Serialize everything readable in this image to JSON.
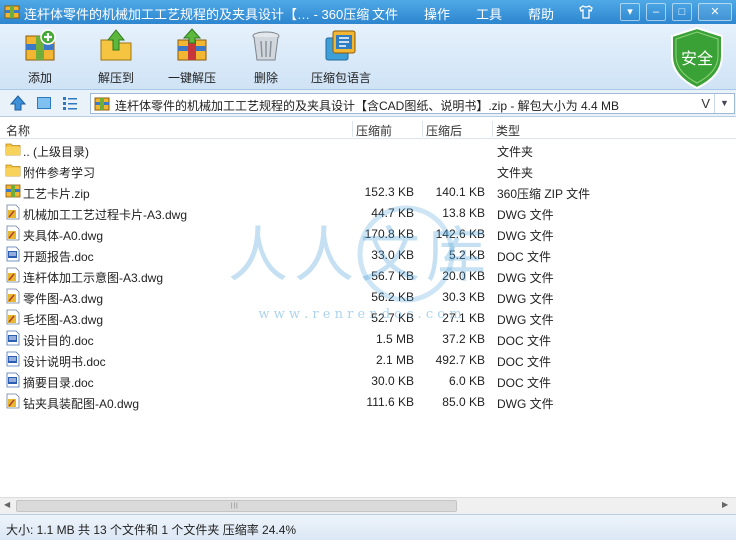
{
  "title_bar": {
    "title": "连杆体零件的机械加工工艺规程的及夹具设计【… - 360压缩",
    "menus": [
      "文件",
      "操作",
      "工具",
      "帮助"
    ]
  },
  "toolbar": {
    "buttons": [
      "添加",
      "解压到",
      "一键解压",
      "删除",
      "压缩包语言"
    ],
    "badge": "安全"
  },
  "address": {
    "path": "连杆体零件的机械加工工艺规程的及夹具设计【含CAD图纸、说明书】.zip - 解包大小为 4.4 MB",
    "dropdown_glyph": "V"
  },
  "columns": [
    "名称",
    "压缩前",
    "压缩后",
    "类型"
  ],
  "files": [
    {
      "name": ".. (上级目录)",
      "compressed": "",
      "uncompressed": "",
      "type": "文件夹",
      "icon": "folder-icon"
    },
    {
      "name": "附件参考学习",
      "compressed": "",
      "uncompressed": "",
      "type": "文件夹",
      "icon": "folder-icon"
    },
    {
      "name": "工艺卡片.zip",
      "compressed": "152.3 KB",
      "uncompressed": "140.1 KB",
      "type": "360压缩 ZIP 文件",
      "icon": "zip-icon"
    },
    {
      "name": "机械加工工艺过程卡片-A3.dwg",
      "compressed": "44.7 KB",
      "uncompressed": "13.8 KB",
      "type": "DWG 文件",
      "icon": "dwg-icon"
    },
    {
      "name": "夹具体-A0.dwg",
      "compressed": "170.8 KB",
      "uncompressed": "142.6 KB",
      "type": "DWG 文件",
      "icon": "dwg-icon"
    },
    {
      "name": "开题报告.doc",
      "compressed": "33.0 KB",
      "uncompressed": "5.2 KB",
      "type": "DOC 文件",
      "icon": "doc-icon"
    },
    {
      "name": "连杆体加工示意图-A3.dwg",
      "compressed": "56.7 KB",
      "uncompressed": "20.0 KB",
      "type": "DWG 文件",
      "icon": "dwg-icon"
    },
    {
      "name": "零件图-A3.dwg",
      "compressed": "56.2 KB",
      "uncompressed": "30.3 KB",
      "type": "DWG 文件",
      "icon": "dwg-icon"
    },
    {
      "name": "毛坯图-A3.dwg",
      "compressed": "52.7 KB",
      "uncompressed": "27.1 KB",
      "type": "DWG 文件",
      "icon": "dwg-icon"
    },
    {
      "name": "设计目的.doc",
      "compressed": "1.5 MB",
      "uncompressed": "37.2 KB",
      "type": "DOC 文件",
      "icon": "doc-icon"
    },
    {
      "name": "设计说明书.doc",
      "compressed": "2.1 MB",
      "uncompressed": "492.7 KB",
      "type": "DOC 文件",
      "icon": "doc-icon"
    },
    {
      "name": "摘要目录.doc",
      "compressed": "30.0 KB",
      "uncompressed": "6.0 KB",
      "type": "DOC 文件",
      "icon": "doc-icon"
    },
    {
      "name": "钻夹具装配图-A0.dwg",
      "compressed": "111.6 KB",
      "uncompressed": "85.0 KB",
      "type": "DWG 文件",
      "icon": "dwg-icon"
    }
  ],
  "watermark": {
    "text": "人人文库",
    "url_text": "w w w . r e n r e n d o c . c o m"
  },
  "status": {
    "text": "大小: 1.1 MB 共 13 个文件和 1 个文件夹 压缩率 24.4%"
  },
  "colors": {
    "titlebar": "#3a95da",
    "shield": "#3aa136",
    "watermark": "#4aa0d8"
  }
}
